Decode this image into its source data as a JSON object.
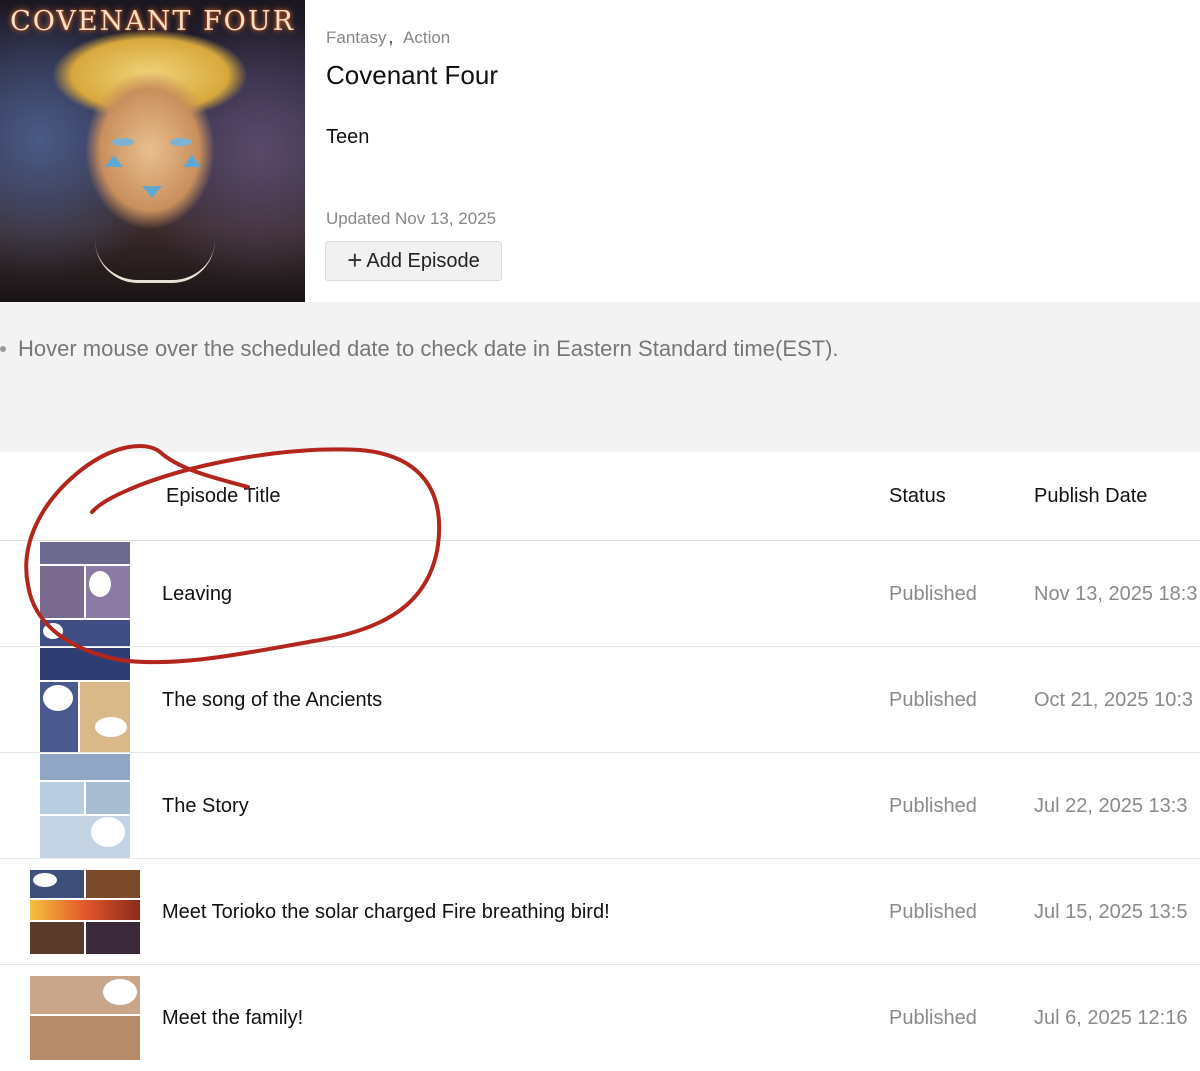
{
  "series": {
    "cover_title": "COVENANT FOUR",
    "genres": [
      "Fantasy",
      "Action"
    ],
    "genre_separator": ",",
    "title": "Covenant Four",
    "age_rating": "Teen",
    "updated": "Updated Nov 13, 2025",
    "add_episode_label": "Add Episode"
  },
  "notice": {
    "text": "Hover mouse over the scheduled date to check date in Eastern Standard time(EST)."
  },
  "table": {
    "headers": {
      "title": "Episode Title",
      "status": "Status",
      "publish_date": "Publish Date"
    },
    "episodes": [
      {
        "title": "Leaving",
        "status": "Published",
        "date": "Nov 13, 2025 18:3"
      },
      {
        "title": "The song of the Ancients",
        "status": "Published",
        "date": "Oct 21, 2025 10:3"
      },
      {
        "title": "The Story",
        "status": "Published",
        "date": "Jul 22, 2025 13:3"
      },
      {
        "title": "Meet Torioko the solar charged Fire breathing bird!",
        "status": "Published",
        "date": "Jul 15, 2025 13:5"
      },
      {
        "title": "Meet the family!",
        "status": "Published",
        "date": "Jul 6, 2025 12:16"
      }
    ]
  },
  "colors": {
    "annotation": "#b3261e",
    "muted_text": "#888888",
    "notice_bg": "#f3f3f3"
  }
}
